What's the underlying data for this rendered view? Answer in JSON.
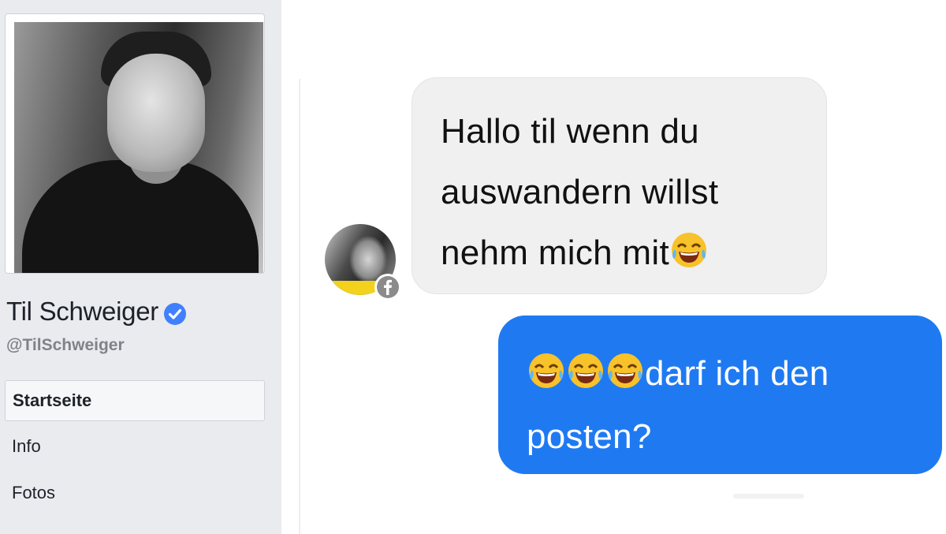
{
  "sidebar": {
    "page_name": "Til Schweiger",
    "handle": "@TilSchweiger",
    "verified": true,
    "nav": [
      {
        "label": "Startseite",
        "active": true
      },
      {
        "label": "Info",
        "active": false
      },
      {
        "label": "Fotos",
        "active": false
      }
    ]
  },
  "conversation": {
    "incoming": {
      "lines": [
        "Hallo til wenn du",
        "auswandern willst",
        "nehm mich mit"
      ],
      "trailing_emoji": "tears-of-joy-emoji"
    },
    "outgoing": {
      "leading_emojis": [
        "tears-of-joy-emoji",
        "tears-of-joy-emoji",
        "tears-of-joy-emoji"
      ],
      "line1": "darf ich den",
      "line2": "posten?"
    }
  },
  "colors": {
    "sidebar_bg": "#e9ebee",
    "incoming_bubble": "#f0f0f0",
    "outgoing_bubble": "#1f7af2",
    "verified_badge": "#4080ff",
    "facebook_badge": "#8b8b8b"
  }
}
